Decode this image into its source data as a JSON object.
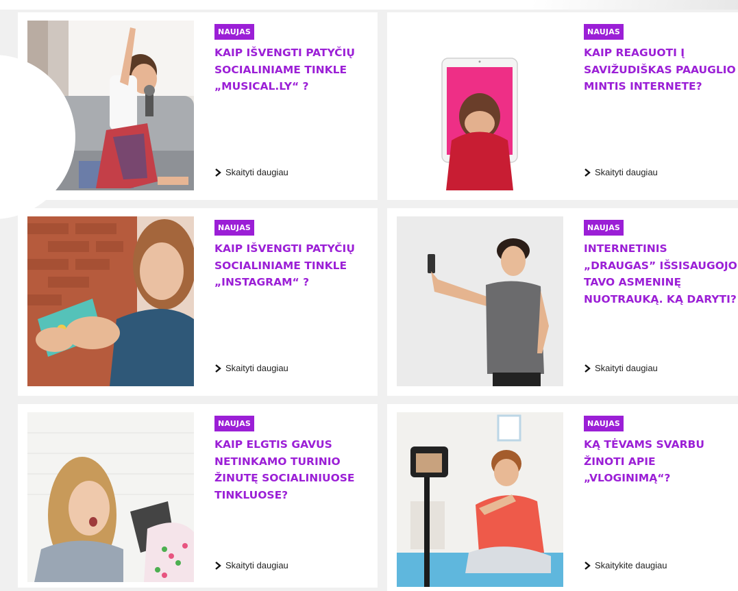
{
  "cards": [
    {
      "badge": "NAUJAS",
      "title": "KAIP IŠVENGTI PATYČIŲ SOCIALINIAME TINKLE „MUSICAL.LY“ ?",
      "link": "Skaityti daugiau",
      "image": "boy-singing-microphone-photo"
    },
    {
      "badge": "NAUJAS",
      "title": "KAIP REAGUOTI Į SAVIŽUDIŠKAS PAAUGLIO MINTIS INTERNETE?",
      "link": "Skaityti daugiau",
      "image": "tablet-crying-girl-photo"
    },
    {
      "badge": "NAUJAS",
      "title": "KAIP IŠVENGTI PATYČIŲ SOCIALINIAME TINKLE „INSTAGRAM“ ?",
      "link": "Skaityti daugiau",
      "image": "girl-gaming-photo"
    },
    {
      "badge": "NAUJAS",
      "title": "INTERNETINIS „DRAUGAS” IŠSISAUGOJO TAVO ASMENINĘ NUOTRAUKĄ. KĄ DARYTI?",
      "link": "Skaityti daugiau",
      "image": "boy-selfie-photo"
    },
    {
      "badge": "NAUJAS",
      "title": "KAIP ELGTIS GAVUS NETINKAMO TURINIO ŽINUTĘ SOCIALINIUOSE TINKLUOSE?",
      "link": "Skaityti daugiau",
      "image": "girl-shocked-tablet-photo"
    },
    {
      "badge": "NAUJAS",
      "title": "KĄ TĖVAMS SVARBU ŽINOTI APIE „VLOGINIMĄ“?",
      "link": "Skaitykite daugiau",
      "image": "boy-vlogging-camera-photo"
    }
  ],
  "colors": {
    "accent": "#9b1fd6",
    "card_bg": "#ffffff",
    "page_bg": "#f0f0f0",
    "link_text": "#222222"
  },
  "icons": {
    "read_more": "chevron-right-icon"
  }
}
